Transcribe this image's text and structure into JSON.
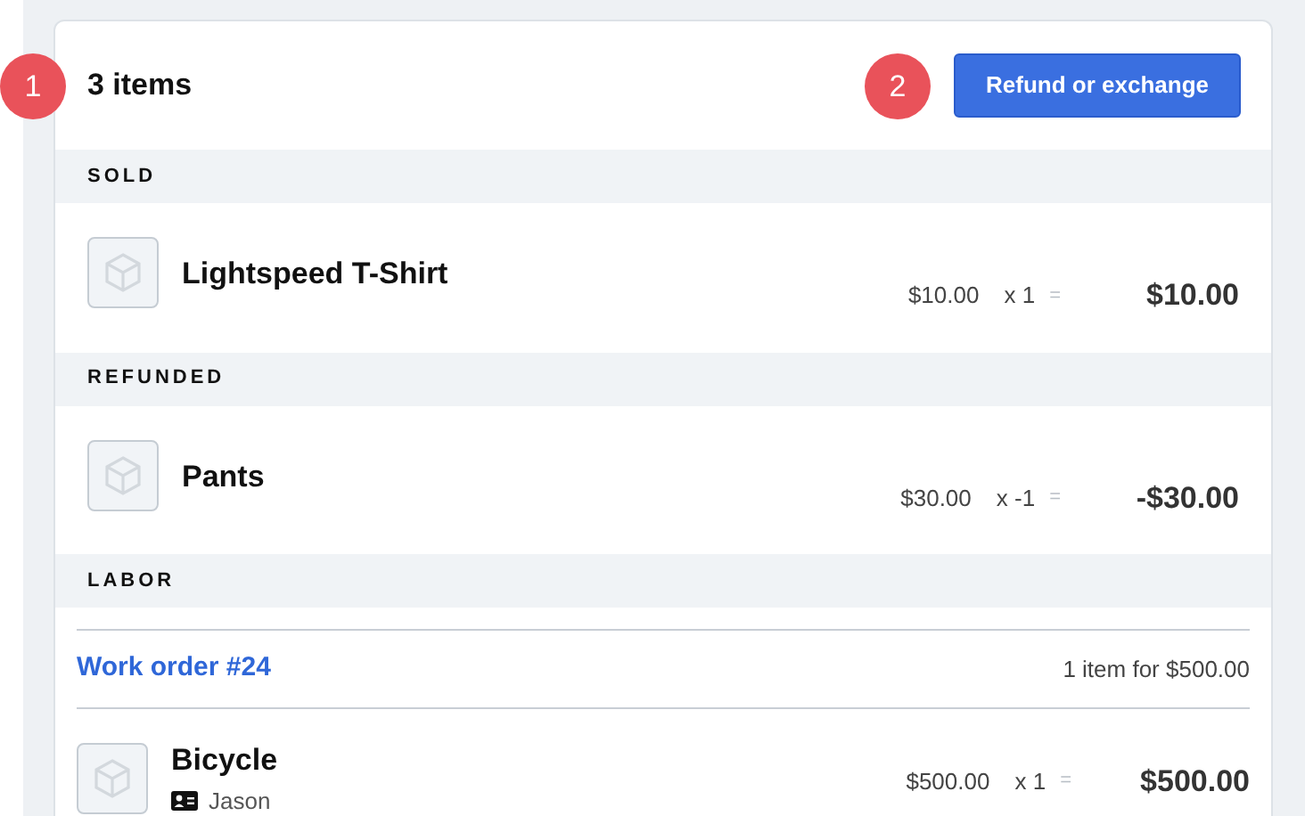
{
  "header": {
    "count": "3 items",
    "button": "Refund or exchange"
  },
  "callouts": [
    "1",
    "2"
  ],
  "sections": [
    {
      "title": "SOLD",
      "items": [
        {
          "name": "Lightspeed T-Shirt",
          "price": "$10.00",
          "qty": "x 1",
          "eq": "=",
          "total": "$10.00"
        }
      ]
    },
    {
      "title": "REFUNDED",
      "items": [
        {
          "name": "Pants",
          "price": "$30.00",
          "qty": "x -1",
          "eq": "=",
          "total": "-$30.00"
        }
      ]
    },
    {
      "title": "LABOR",
      "work_order": {
        "link": "Work order #24",
        "summary": "1 item for $500.00"
      },
      "items": [
        {
          "name": "Bicycle",
          "employee": "Jason",
          "price": "$500.00",
          "qty": "x 1",
          "eq": "=",
          "total": "$500.00"
        }
      ]
    }
  ]
}
